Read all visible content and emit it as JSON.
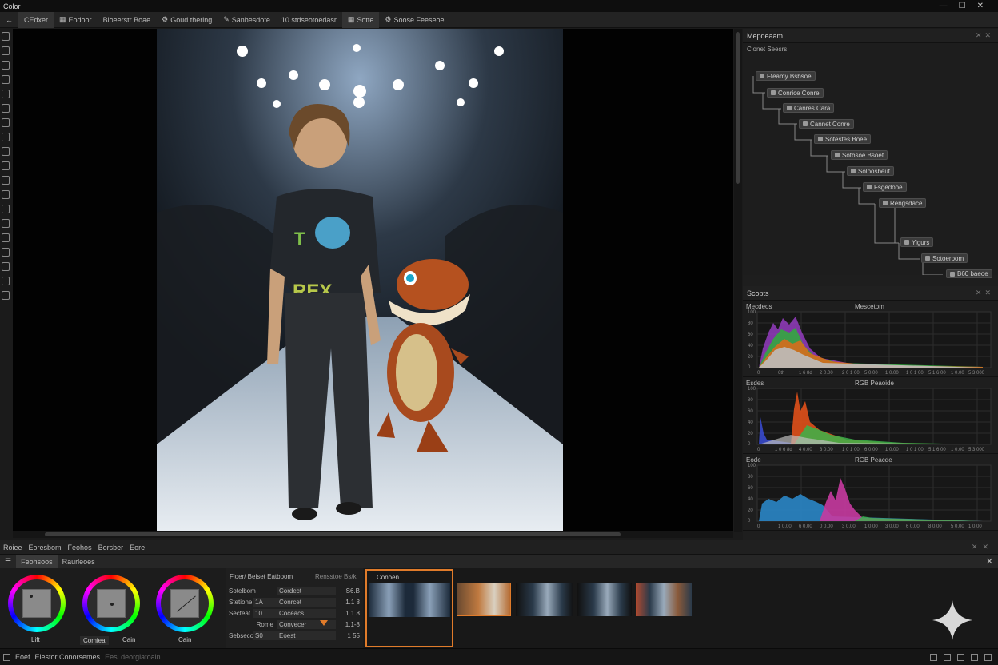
{
  "window": {
    "title": "Color",
    "controls": [
      "—",
      "☐",
      "✕"
    ]
  },
  "toolbar": {
    "items": [
      {
        "icon": "back-arrow-icon",
        "label": "←"
      },
      {
        "label": "CEdxer"
      },
      {
        "icon": "grid-icon",
        "label": "Eodoor"
      },
      {
        "label": "Bioeerstr Boae"
      },
      {
        "icon": "gear-icon",
        "label": "Goud thering"
      },
      {
        "icon": "pen-icon",
        "label": "Sanbesdote"
      },
      {
        "label": "10 stdseotoedasr"
      },
      {
        "icon": "grid-icon",
        "label": "Sotte"
      },
      {
        "icon": "gear-icon",
        "label": "Soose Feeseoe"
      }
    ]
  },
  "node_editor": {
    "header": "Mepdeaam",
    "section_label": "Clonet Seesrs",
    "nodes": [
      "Fteamy Bsbsoe",
      "Conrice Conre",
      "Canres Cara",
      "Cannet Conre",
      "Sotestes Boee",
      "Sotbsoe Bsoet",
      "Soloosbeut",
      "Fsgedooe",
      "Rengsdace",
      "Yigurs",
      "Sotoeroom",
      "B60 baeoe"
    ]
  },
  "scopes": {
    "header": "Scopts",
    "panels": [
      {
        "label": "Mecdeos",
        "title": "Mescetom",
        "yticks": [
          "100",
          "80",
          "60",
          "40",
          "20",
          "0"
        ],
        "xticks": [
          "0",
          "6th",
          "1 6 8d",
          "2 0.00",
          "2 0 1 00",
          "5 0.00",
          "1 0.00",
          "1 0 1 00",
          "5 1 6 00",
          "1 0.00",
          "5 3 000"
        ]
      },
      {
        "label": "Esdes",
        "title": "RGB Peaoide",
        "yticks": [
          "100",
          "80",
          "60",
          "40",
          "20",
          "0"
        ],
        "xticks": [
          "0",
          "1 0 6 8d",
          "4 0.00",
          "3 0.00",
          "1 0 1 00",
          "6 0.00",
          "1 0.00",
          "1 0 1 00",
          "5 1 6 00",
          "1 0.00",
          "5 3 000"
        ]
      },
      {
        "label": "Eode",
        "title": "RGB Peacde",
        "yticks": [
          "100",
          "80",
          "60",
          "40",
          "20",
          "0"
        ],
        "xticks": [
          "0",
          "1 0.00",
          "6 0.00",
          "0 0.00",
          "3 0.00",
          "1 0.00",
          "3 0.00",
          "6 0.00",
          "8 0.00",
          "5 0.00",
          "1 0.00"
        ]
      }
    ]
  },
  "bottom_tabs": [
    "Roiee",
    "Eoresbom",
    "Feohos",
    "Borsber",
    "Eore"
  ],
  "sub_tabs": [
    "Feohsoos",
    "Raurleoes"
  ],
  "color_wheels": [
    {
      "label": "Lift"
    },
    {
      "label": "Comiea",
      "label2": "Cain"
    },
    {
      "label": "Cain"
    }
  ],
  "params": {
    "header": "Floer/ Beiset Eatboom",
    "header_right": "Rensstoe Bs/k",
    "rows": [
      {
        "name": "Sotelbom",
        "val": "",
        "sub": "Cordect",
        "num": "S6.B"
      },
      {
        "name": "Stetione",
        "val": "1A",
        "sub": "Conrcet",
        "num": "1.1 8"
      },
      {
        "name": "Secteat",
        "val": "10",
        "sub": "Coceacs",
        "num": "1 1 8"
      },
      {
        "name": "Rome",
        "val": "",
        "sub": "Convecer",
        "num": "1.1-8"
      },
      {
        "name": "Sebsecoe",
        "val": "S0",
        "sub": "Eoest",
        "num": "1 55"
      }
    ]
  },
  "timeline": {
    "selected_label": "Conoen"
  },
  "status": {
    "left": "Elestor Conorsemes",
    "mid": "Eesl deorglatoain",
    "prefix": "Eoef"
  },
  "colors": {
    "accent": "#e07b2a",
    "panel": "#1e1e1e",
    "bg": "#1b1b1b"
  }
}
